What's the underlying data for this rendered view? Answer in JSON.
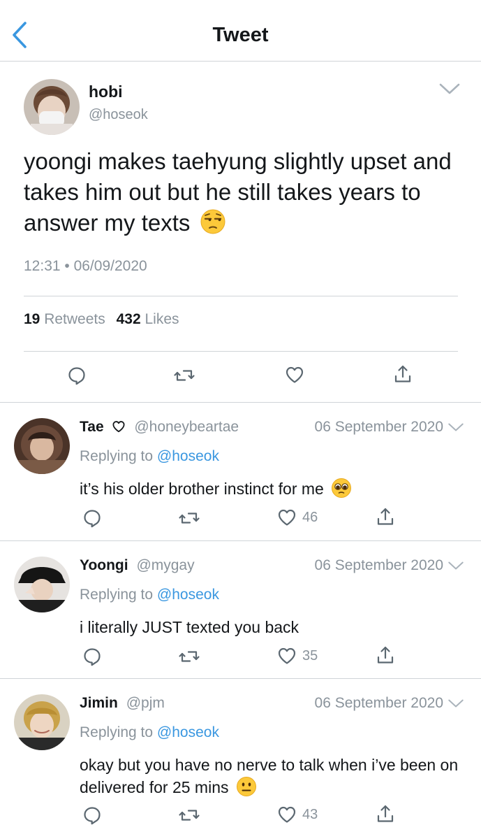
{
  "header": {
    "title": "Tweet"
  },
  "main_tweet": {
    "name": "hobi",
    "handle": "@hoseok",
    "text": "yoongi makes taehyung slightly upset and takes him out but he still takes years to answer my texts",
    "emoji": "unamused-face",
    "timestamp": "12:31 • 06/09/2020",
    "retweets_count": "19",
    "retweets_label": "Retweets",
    "likes_count": "432",
    "likes_label": "Likes"
  },
  "replies": [
    {
      "name": "Tae",
      "name_icon": "heart-outline-icon",
      "handle": "@honeybeartae",
      "date": "06 September 2020",
      "replying_prefix": "Replying to",
      "replying_to": "@hoseok",
      "text": "it’s his older brother instinct for me",
      "emoji": "pleading-face",
      "likes": "46"
    },
    {
      "name": "Yoongi",
      "handle": "@mygay",
      "date": "06 September 2020",
      "replying_prefix": "Replying to",
      "replying_to": "@hoseok",
      "text": "i literally JUST texted you back",
      "likes": "35"
    },
    {
      "name": "Jimin",
      "handle": "@pjm",
      "date": "06 September 2020",
      "replying_prefix": "Replying to",
      "replying_to": "@hoseok",
      "text": "okay but you have no nerve to talk when i’ve been on delivered for 25 mins",
      "emoji": "neutral-face",
      "likes": "43"
    }
  ],
  "colors": {
    "accent": "#3a97e0",
    "muted": "#8a939b",
    "divider": "#d0d4d8"
  }
}
